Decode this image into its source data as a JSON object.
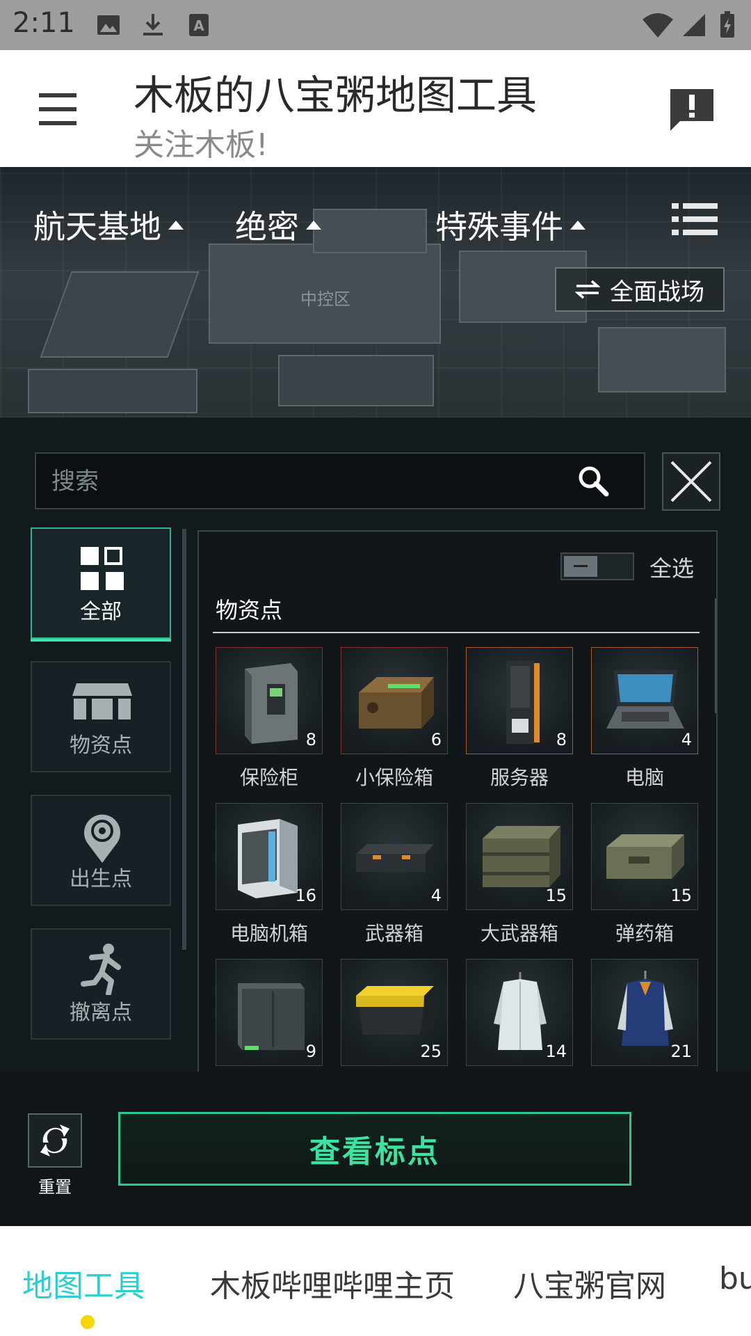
{
  "status_bar": {
    "time": "2:11",
    "icons": [
      "image-icon",
      "download-icon",
      "font-a-icon",
      "wifi-icon",
      "signal-icon",
      "battery-charging-icon"
    ]
  },
  "app_bar": {
    "title": "木板的八宝粥地图工具",
    "subtitle": "关注木板!",
    "icons": [
      "menu-icon",
      "feedback-alert-icon"
    ]
  },
  "map": {
    "dropdowns": [
      "航天基地",
      "绝密",
      "特殊事件"
    ],
    "zone_label": "中控区",
    "mode_button": "全面战场",
    "icons": [
      "list-icon",
      "swap-icon"
    ]
  },
  "panel": {
    "search": {
      "placeholder": "搜索",
      "value": ""
    },
    "categories": [
      {
        "label": "全部",
        "icon": "grid-icon",
        "active": true
      },
      {
        "label": "物资点",
        "icon": "crate-icon",
        "active": false
      },
      {
        "label": "出生点",
        "icon": "spawn-target-icon",
        "active": false
      },
      {
        "label": "撤离点",
        "icon": "running-man-icon",
        "active": false
      }
    ],
    "select_all_label": "全选",
    "select_all_on": false,
    "section_title": "物资点",
    "items": [
      {
        "name": "保险柜",
        "count": "8",
        "icon": "safe-cabinet-icon"
      },
      {
        "name": "小保险箱",
        "count": "6",
        "icon": "small-safe-icon"
      },
      {
        "name": "服务器",
        "count": "8",
        "icon": "server-icon"
      },
      {
        "name": "电脑",
        "count": "4",
        "icon": "laptop-icon"
      },
      {
        "name": "电脑机箱",
        "count": "16",
        "icon": "pc-case-icon"
      },
      {
        "name": "武器箱",
        "count": "4",
        "icon": "weapon-case-icon"
      },
      {
        "name": "大武器箱",
        "count": "15",
        "icon": "large-weapon-crate-icon"
      },
      {
        "name": "弹药箱",
        "count": "15",
        "icon": "ammo-box-icon"
      },
      {
        "name": "",
        "count": "9",
        "icon": "metal-cabinet-icon"
      },
      {
        "name": "",
        "count": "25",
        "icon": "tool-box-icon"
      },
      {
        "name": "",
        "count": "14",
        "icon": "white-coat-icon"
      },
      {
        "name": "",
        "count": "21",
        "icon": "jacket-icon"
      }
    ]
  },
  "actions": {
    "reset_label": "重置",
    "view_button": "查看标点"
  },
  "tabs": [
    "地图工具",
    "木板哔哩哔哩主页",
    "八宝粥官网",
    "bu"
  ],
  "colors": {
    "accent": "#3ce29e",
    "active_tab": "#2ccfcf",
    "dot": "#f2d800"
  }
}
